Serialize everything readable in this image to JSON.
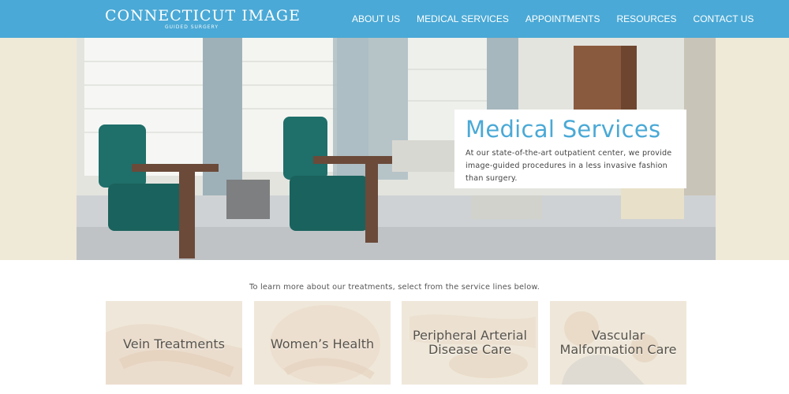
{
  "header": {
    "logo_title": "CONNECTICUT IMAGE",
    "logo_subtitle": "GUIDED SURGERY",
    "nav": [
      {
        "label": "ABOUT US"
      },
      {
        "label": "MEDICAL SERVICES"
      },
      {
        "label": "APPOINTMENTS"
      },
      {
        "label": "RESOURCES"
      },
      {
        "label": "CONTACT US"
      }
    ]
  },
  "hero": {
    "title": "Medical Services",
    "text": "At our state-of-the-art outpatient center, we provide image-guided procedures in a less invasive fashion than surgery."
  },
  "intro": "To learn more about our treatments, select from the service lines below.",
  "services": [
    {
      "label": "Vein Treatments"
    },
    {
      "label": "Women’s Health"
    },
    {
      "label": "Peripheral Arterial Disease Care"
    },
    {
      "label": "Vascular Malformation Care"
    }
  ],
  "colors": {
    "brand_blue": "#4aa9d6",
    "band_beige": "#efe9d8",
    "tile_beige": "#efe9db",
    "chair_teal": "#1f6f6a"
  }
}
